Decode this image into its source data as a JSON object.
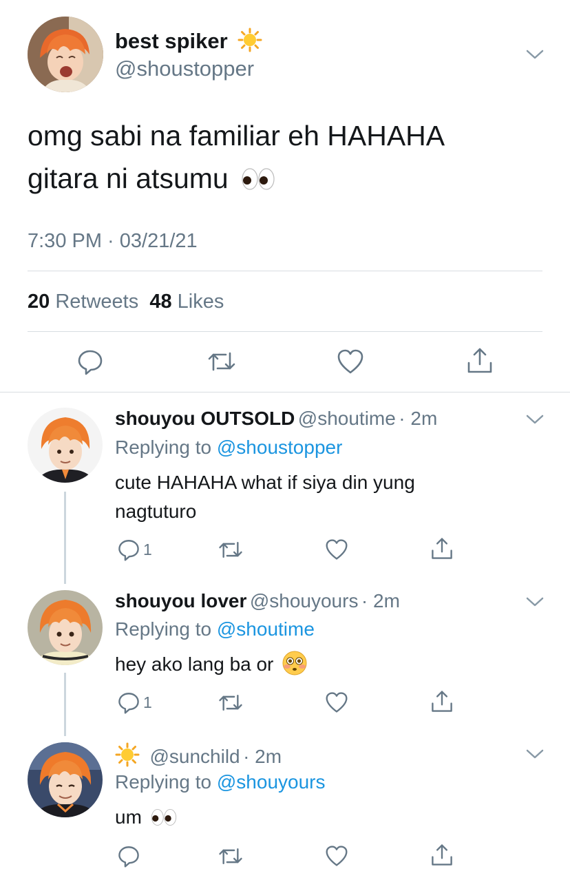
{
  "main_tweet": {
    "display_name": "best spiker",
    "handle": "@shoustopper",
    "text_line1": "omg sabi na familiar eh HAHAHA",
    "text_line2": "gitara ni atsumu",
    "timestamp": "7:30 PM · 03/21/21",
    "retweets_count": "20",
    "retweets_label": "Retweets",
    "likes_count": "48",
    "likes_label": "Likes"
  },
  "replies": [
    {
      "display_name": "shouyou OUTSOLD",
      "handle": "@shoutime",
      "time": "· 2m",
      "replying_prefix": "Replying to",
      "replying_to": "@shoustopper",
      "text_line1": "cute HAHAHA what if siya din yung",
      "text_line2": "nagtuturo",
      "reply_count": "1"
    },
    {
      "display_name": "shouyou lover",
      "handle": "@shouyours",
      "time": "· 2m",
      "replying_prefix": "Replying to",
      "replying_to": "@shoutime",
      "text_line1": "hey ako lang ba or",
      "reply_count": "1"
    },
    {
      "display_name": "",
      "handle": "@sunchild",
      "time": "· 2m",
      "replying_prefix": "Replying to",
      "replying_to": "@shouyours",
      "text_line1": "um",
      "reply_count": ""
    }
  ],
  "icons": {
    "reply": "reply-icon",
    "retweet": "retweet-icon",
    "like": "heart-icon",
    "share": "share-icon",
    "chevron": "chevron-down-icon",
    "sun_emoji": "sun-emoji-icon",
    "eyes_emoji": "eyes-emoji-icon",
    "flushed_emoji": "flushed-face-emoji-icon"
  },
  "colors": {
    "text": "#14171a",
    "secondary": "#657786",
    "link": "#1b95e0",
    "divider": "#d8dde1"
  }
}
